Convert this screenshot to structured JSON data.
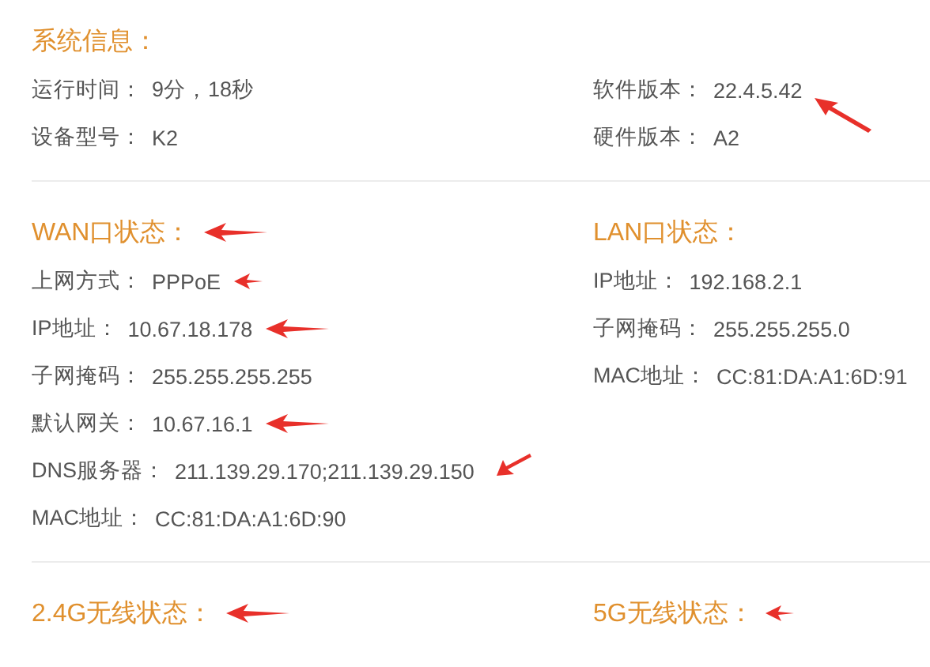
{
  "sections": [
    {
      "columns": [
        {
          "title": "系统信息：",
          "rows": [
            {
              "label": "运行时间：",
              "value": "9分，18秒"
            },
            {
              "label": "设备型号：",
              "value": "K2"
            }
          ]
        },
        {
          "rows": [
            {
              "label": "软件版本：",
              "value": "22.4.5.42",
              "arrow": {
                "kind": "up-left"
              }
            },
            {
              "label": "硬件版本：",
              "value": "A2"
            }
          ]
        }
      ]
    },
    {
      "columns": [
        {
          "title": "WAN口状态：",
          "title_arrow": {
            "kind": "left"
          },
          "rows": [
            {
              "label": "上网方式：",
              "value": "PPPoE",
              "arrow": {
                "kind": "small"
              }
            },
            {
              "label": "IP地址：",
              "value": "10.67.18.178",
              "arrow": {
                "kind": "left"
              }
            },
            {
              "label": "子网掩码：",
              "value": "255.255.255.255"
            },
            {
              "label": "默认网关：",
              "value": "10.67.16.1",
              "arrow": {
                "kind": "left"
              }
            },
            {
              "label": "DNS服务器：",
              "value": "211.139.29.170;211.139.29.150",
              "arrow": {
                "kind": "down-left"
              }
            },
            {
              "label": "MAC地址：",
              "value": "CC:81:DA:A1:6D:90"
            }
          ]
        },
        {
          "title": "LAN口状态：",
          "rows": [
            {
              "label": "IP地址：",
              "value": "192.168.2.1"
            },
            {
              "label": "子网掩码：",
              "value": "255.255.255.0"
            },
            {
              "label": "MAC地址：",
              "value": "CC:81:DA:A1:6D:91"
            }
          ]
        }
      ]
    },
    {
      "columns": [
        {
          "title": "2.4G无线状态：",
          "title_arrow": {
            "kind": "left"
          }
        },
        {
          "title": "5G无线状态：",
          "title_arrow": {
            "kind": "small"
          }
        }
      ]
    }
  ]
}
